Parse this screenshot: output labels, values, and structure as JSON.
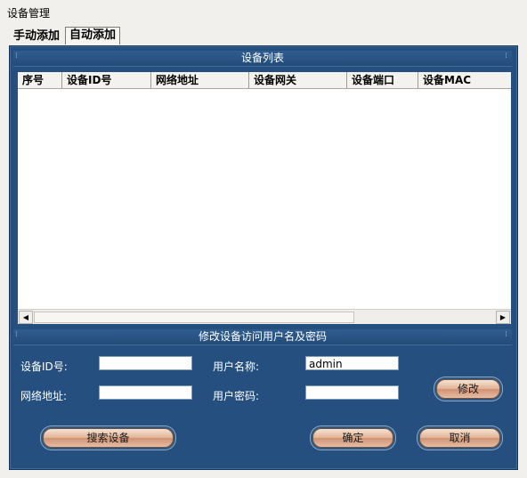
{
  "window": {
    "title": "设备管理"
  },
  "tabs": [
    {
      "label": "手动添加"
    },
    {
      "label": "自动添加"
    }
  ],
  "device_list": {
    "heading": "设备列表",
    "columns": [
      "序号",
      "设备ID号",
      "网络地址",
      "设备网关",
      "设备端口",
      "设备MAC"
    ],
    "rows": []
  },
  "credentials": {
    "heading": "修改设备访问用户名及密码",
    "device_id_label": "设备ID号:",
    "device_id_value": "",
    "ip_label": "网络地址:",
    "ip_value": "",
    "username_label": "用户名称:",
    "username_value": "admin",
    "password_label": "用户密码:",
    "password_value": "",
    "modify_button": "修改"
  },
  "footer": {
    "search_button": "搜索设备",
    "ok_button": "确定",
    "cancel_button": "取消"
  }
}
